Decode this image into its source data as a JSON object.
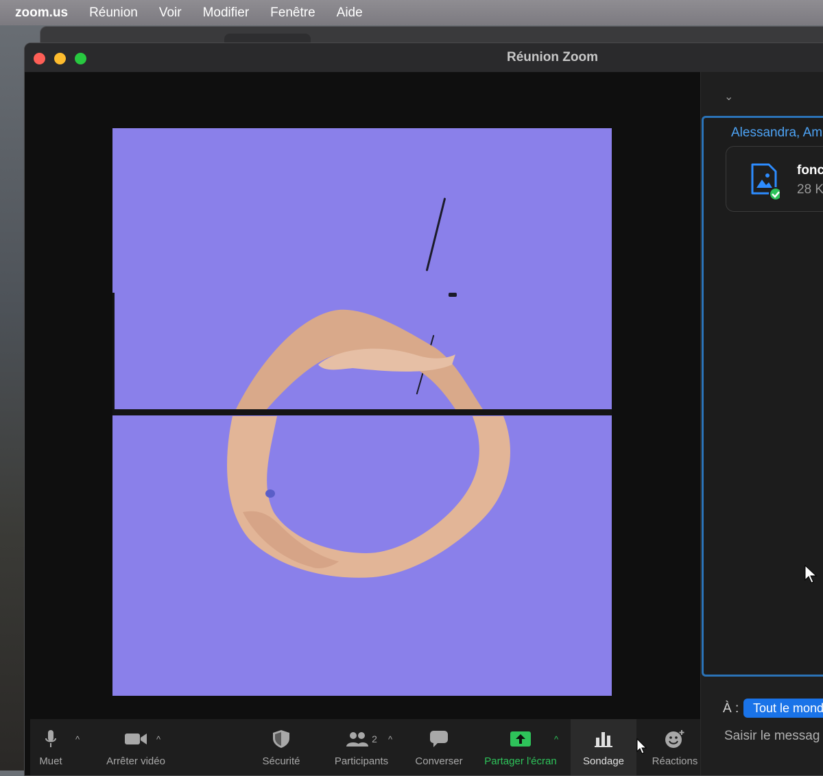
{
  "menubar": {
    "app": "zoom.us",
    "items": [
      "Réunion",
      "Voir",
      "Modifier",
      "Fenêtre",
      "Aide"
    ]
  },
  "window": {
    "title": "Réunion Zoom"
  },
  "toolbar": {
    "mute": "Muet",
    "stop_video": "Arrêter vidéo",
    "security": "Sécurité",
    "participants": "Participants",
    "participants_count": "2",
    "chat": "Converser",
    "share": "Partager l'écran",
    "poll": "Sondage",
    "reactions": "Réactions"
  },
  "chat": {
    "sender": "Alessandra, Am",
    "file_name": "fonc",
    "file_size": "28 K",
    "to_label": "À :",
    "recipient": "Tout le mond",
    "input_placeholder": "Saisir le messag"
  },
  "colors": {
    "video_bg": "#8a80ea",
    "share_green": "#2ec35a",
    "accent_blue": "#1a73e8",
    "link_blue": "#4da3f5"
  }
}
